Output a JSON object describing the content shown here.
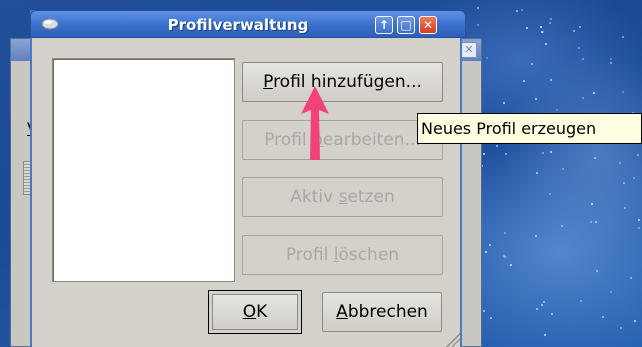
{
  "dialog": {
    "title": "Profilverwaltung",
    "buttons": {
      "add": {
        "pre": "",
        "key": "P",
        "post": "rofil hinzufügen...",
        "enabled": true
      },
      "edit": {
        "pre": "Profil ",
        "key": "b",
        "post": "earbeiten...",
        "enabled": false
      },
      "set_active": {
        "pre": "Aktiv ",
        "key": "s",
        "post": "etzen",
        "enabled": false
      },
      "delete": {
        "pre": "Profil ",
        "key": "l",
        "post": "öschen",
        "enabled": false
      },
      "ok": {
        "pre": "",
        "key": "O",
        "post": "K"
      },
      "cancel": {
        "pre": "",
        "key": "A",
        "post": "bbrechen"
      }
    },
    "profiles": []
  },
  "tooltip": {
    "text": "Neues Profil erzeugen"
  },
  "background_window": {
    "visible_letter": "V"
  },
  "colors": {
    "titlebar": "#3a6fcb",
    "dialog_bg": "#d4d1cb",
    "tooltip_bg": "#ffffe1",
    "arrow": "#f2427a",
    "disabled_text": "#a9a7a2"
  }
}
